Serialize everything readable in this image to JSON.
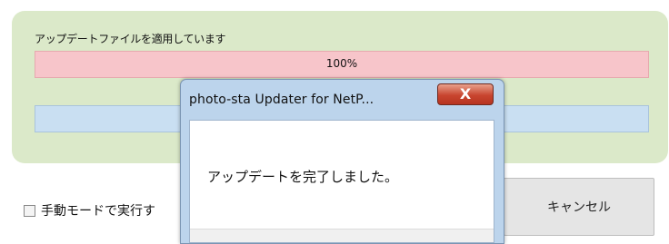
{
  "progress": {
    "label": "アップデートファイルを適用しています",
    "percent_text": "100%",
    "percent": 100
  },
  "manual_mode": {
    "label": "手動モードで実行す",
    "checked": false
  },
  "cancel_button": {
    "label": "キャンセル"
  },
  "dialog": {
    "title": "photo-sta Updater for NetP...",
    "message": "アップデートを完了しました。",
    "close_glyph": "X"
  }
}
